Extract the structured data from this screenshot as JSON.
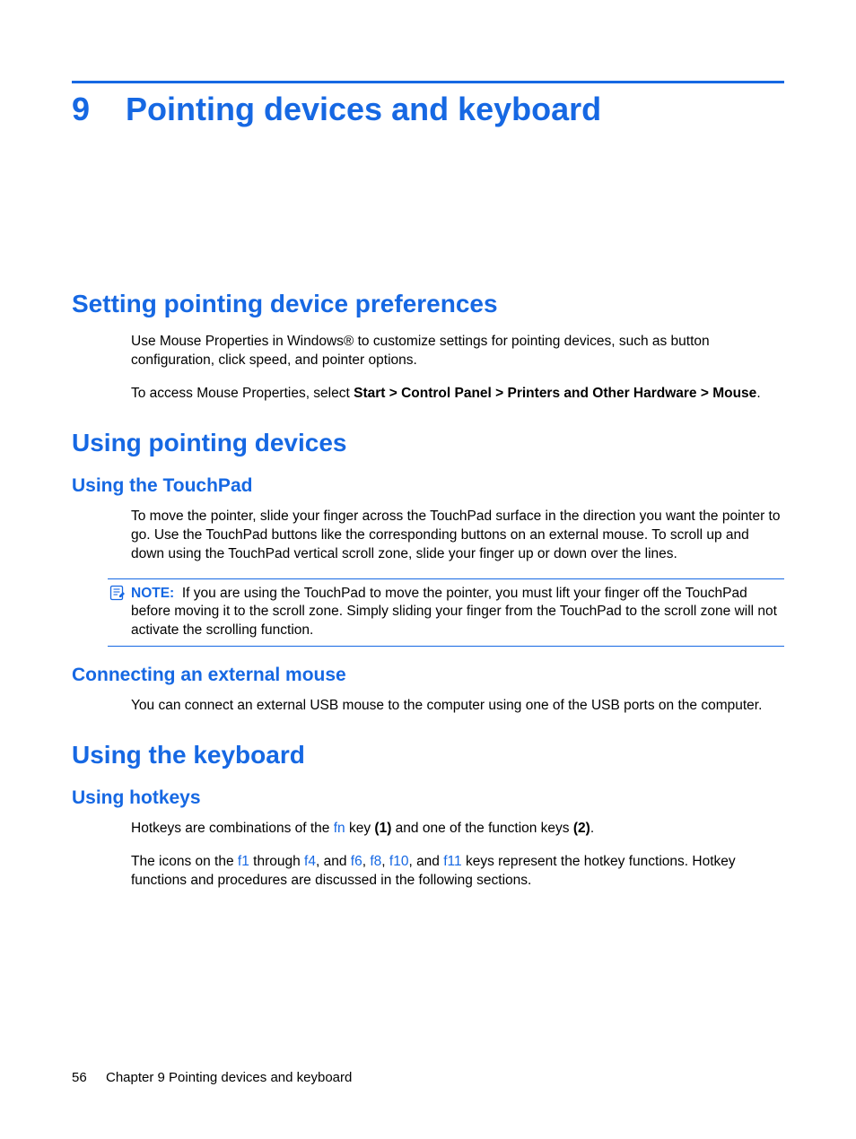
{
  "chapter": {
    "number": "9",
    "title": "Pointing devices and keyboard"
  },
  "sections": {
    "s1": {
      "heading": "Setting pointing device preferences",
      "p1": "Use Mouse Properties in Windows® to customize settings for pointing devices, such as button configuration, click speed, and pointer options.",
      "p2_a": "To access Mouse Properties, select ",
      "p2_b": "Start > Control Panel > Printers and Other Hardware > Mouse",
      "p2_c": "."
    },
    "s2": {
      "heading": "Using pointing devices",
      "sub1": {
        "heading": "Using the TouchPad",
        "p1": "To move the pointer, slide your finger across the TouchPad surface in the direction you want the pointer to go. Use the TouchPad buttons like the corresponding buttons on an external mouse. To scroll up and down using the TouchPad vertical scroll zone, slide your finger up or down over the lines.",
        "note_label": "NOTE:",
        "note_text": "If you are using the TouchPad to move the pointer, you must lift your finger off the TouchPad before moving it to the scroll zone. Simply sliding your finger from the TouchPad to the scroll zone will not activate the scrolling function."
      },
      "sub2": {
        "heading": "Connecting an external mouse",
        "p1": "You can connect an external USB mouse to the computer using one of the USB ports on the computer."
      }
    },
    "s3": {
      "heading": "Using the keyboard",
      "sub1": {
        "heading": "Using hotkeys",
        "p1_a": "Hotkeys are combinations of the ",
        "p1_fn": "fn",
        "p1_b": " key ",
        "p1_bold1": "(1)",
        "p1_c": " and one of the function keys ",
        "p1_bold2": "(2)",
        "p1_d": ".",
        "p2_a": "The icons on the ",
        "p2_f1": "f1",
        "p2_b": " through ",
        "p2_f4": "f4",
        "p2_c": ", and ",
        "p2_f6": "f6",
        "p2_d": ", ",
        "p2_f8": "f8",
        "p2_e": ", ",
        "p2_f10": "f10",
        "p2_f": ", and ",
        "p2_f11": "f11",
        "p2_g": " keys represent the hotkey functions. Hotkey functions and procedures are discussed in the following sections."
      }
    }
  },
  "footer": {
    "page": "56",
    "chapter_label": "Chapter 9   Pointing devices and keyboard"
  }
}
